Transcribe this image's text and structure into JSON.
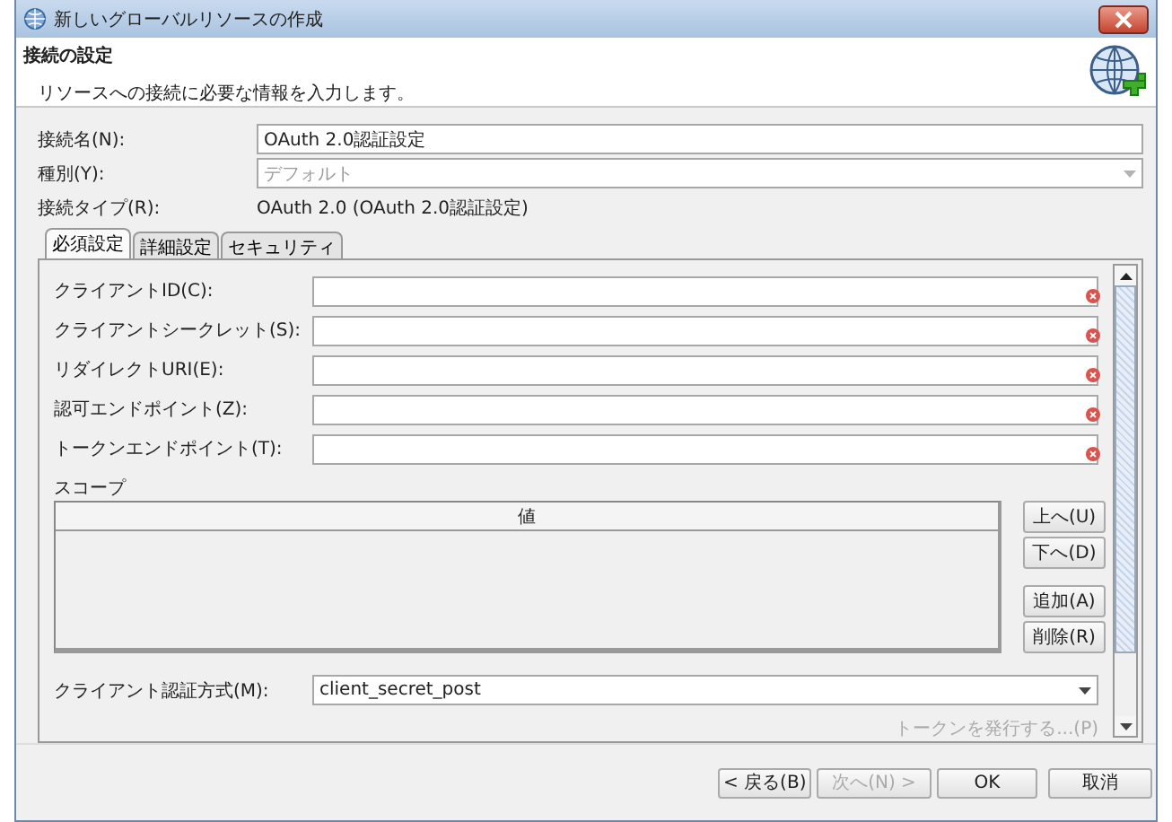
{
  "window": {
    "title": "新しいグローバルリソースの作成"
  },
  "header": {
    "title": "接続の設定",
    "description": "リソースへの接続に必要な情報を入力します。"
  },
  "fields": [
    {
      "kind": "text",
      "label": "接続名(N):",
      "value": "OAuth 2.0認証設定",
      "disabled": false
    },
    {
      "kind": "combo",
      "label": "種別(Y):",
      "value": "デフォルト",
      "disabled": true
    }
  ],
  "connection_type": {
    "label": "接続タイプ(R):",
    "value": "OAuth 2.0 (OAuth 2.0認証設定)"
  },
  "tabs": [
    {
      "label": "必須設定",
      "selected": true
    },
    {
      "label": "詳細設定",
      "selected": false
    },
    {
      "label": "セキュリティ",
      "selected": false
    }
  ],
  "required_fields": [
    {
      "label": "クライアントID(C):",
      "invalid": true
    },
    {
      "label": "クライアントシークレット(S):",
      "invalid": true
    },
    {
      "label": "リダイレクトURI(E):",
      "invalid": true
    },
    {
      "label": "認可エンドポイント(Z):",
      "invalid": true
    },
    {
      "label": "トークンエンドポイント(T):",
      "invalid": true
    }
  ],
  "scope": {
    "label": "スコープ",
    "column": "値",
    "buttons": [
      {
        "label": "上へ(U)",
        "disabled": false
      },
      {
        "label": "下へ(D)",
        "disabled": false
      },
      {
        "label": "追加(A)",
        "disabled": false
      },
      {
        "label": "削除(R)",
        "disabled": false
      }
    ]
  },
  "auth_method": {
    "label": "クライアント認証方式(M):",
    "value": "client_secret_post"
  },
  "issue_token": {
    "label": "トークンを発行する...(P)",
    "disabled": true
  },
  "buttons": [
    {
      "label": "< 戻る(B)",
      "disabled": false
    },
    {
      "label": "次へ(N) >",
      "disabled": true
    },
    {
      "label": "OK",
      "disabled": false
    },
    {
      "label": "取消",
      "disabled": false
    }
  ]
}
